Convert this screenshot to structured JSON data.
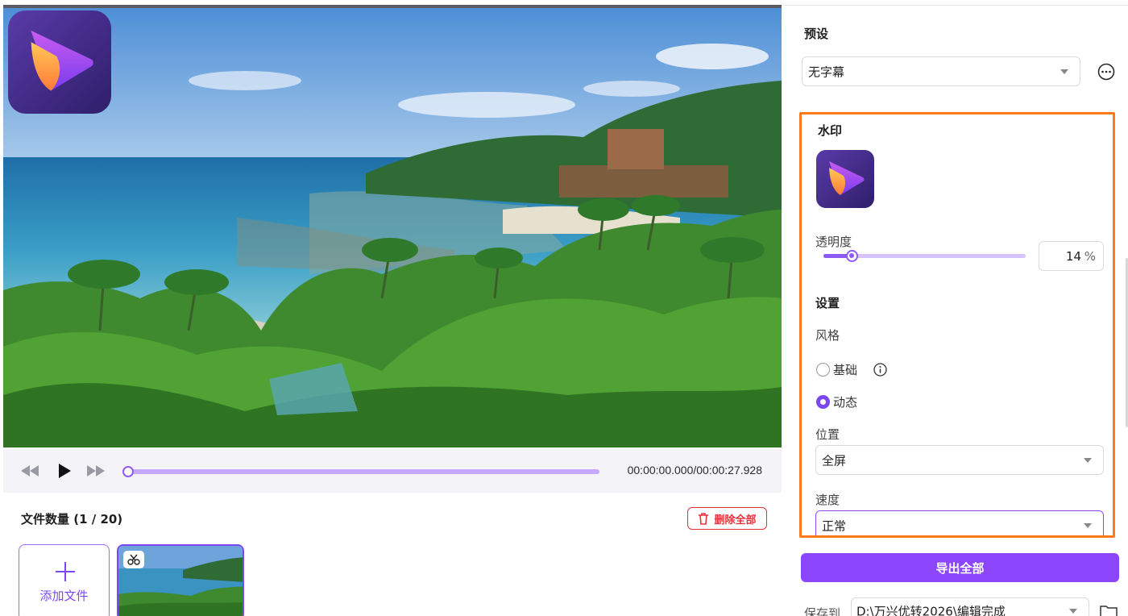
{
  "player": {
    "timecode": "00:00:00.000/00:00:27.928",
    "progress": 0.0
  },
  "files": {
    "header": "文件数量 (1 / 20)",
    "delete_all": "删除全部",
    "add_file": "添加文件"
  },
  "right_panel": {
    "preset_title": "预设",
    "preset_value": "无字幕",
    "watermark_title": "水印",
    "opacity_label": "透明度",
    "opacity_value": "14",
    "opacity_unit": "%",
    "settings_title": "设置",
    "style_label": "风格",
    "style_options": [
      {
        "label": "基础",
        "selected": false
      },
      {
        "label": "动态",
        "selected": true
      }
    ],
    "position_label": "位置",
    "position_value": "全屏",
    "speed_label": "速度",
    "speed_value": "正常",
    "export_button": "导出全部",
    "save_to_label": "保存到",
    "save_path": "D:\\万兴优转2026\\编辑完成"
  },
  "colors": {
    "accent": "#8b46fb",
    "highlight_border": "#ff7a1a",
    "danger": "#e8303b"
  },
  "icons": [
    "rewind-icon",
    "play-icon",
    "fast-forward-icon",
    "trash-icon",
    "plus-icon",
    "scissors-icon",
    "more-icon",
    "info-icon",
    "chevron-down-icon",
    "folder-icon",
    "app-logo-icon"
  ]
}
